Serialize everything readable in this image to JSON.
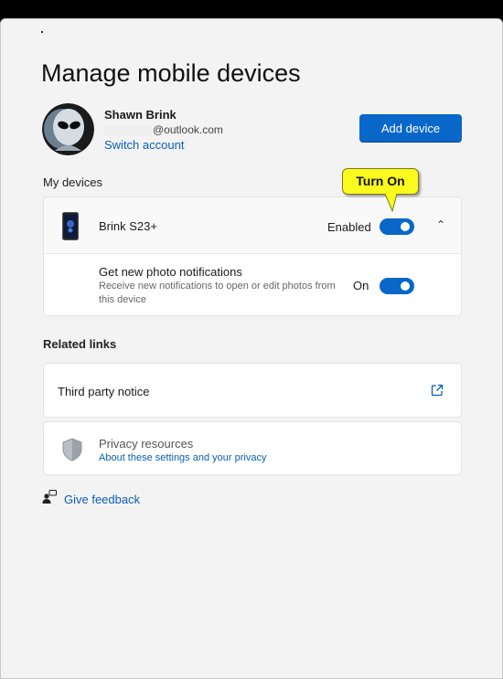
{
  "page_title": "Manage mobile devices",
  "account": {
    "name": "Shawn Brink",
    "email_domain": "@outlook.com",
    "switch_label": "Switch account"
  },
  "add_device_label": "Add device",
  "my_devices": {
    "heading": "My devices",
    "device": {
      "name": "Brink S23+",
      "status_label": "Enabled",
      "enabled": true,
      "expanded": true,
      "notifications": {
        "title": "Get new photo notifications",
        "description": "Receive new notifications to open or edit photos from this device",
        "status_label": "On",
        "enabled": true
      }
    }
  },
  "callout": {
    "text": "Turn On"
  },
  "related": {
    "heading": "Related links",
    "third_party_label": "Third party notice",
    "privacy_title": "Privacy resources",
    "privacy_link": "About these settings and your privacy"
  },
  "feedback_label": "Give feedback",
  "colors": {
    "accent": "#0867c8",
    "link": "#0a5fb4",
    "callout": "#fafa1e"
  },
  "icons": [
    "avatar-alien",
    "phone-icon",
    "chevron-up-icon",
    "external-link-icon",
    "shield-icon",
    "feedback-icon"
  ]
}
